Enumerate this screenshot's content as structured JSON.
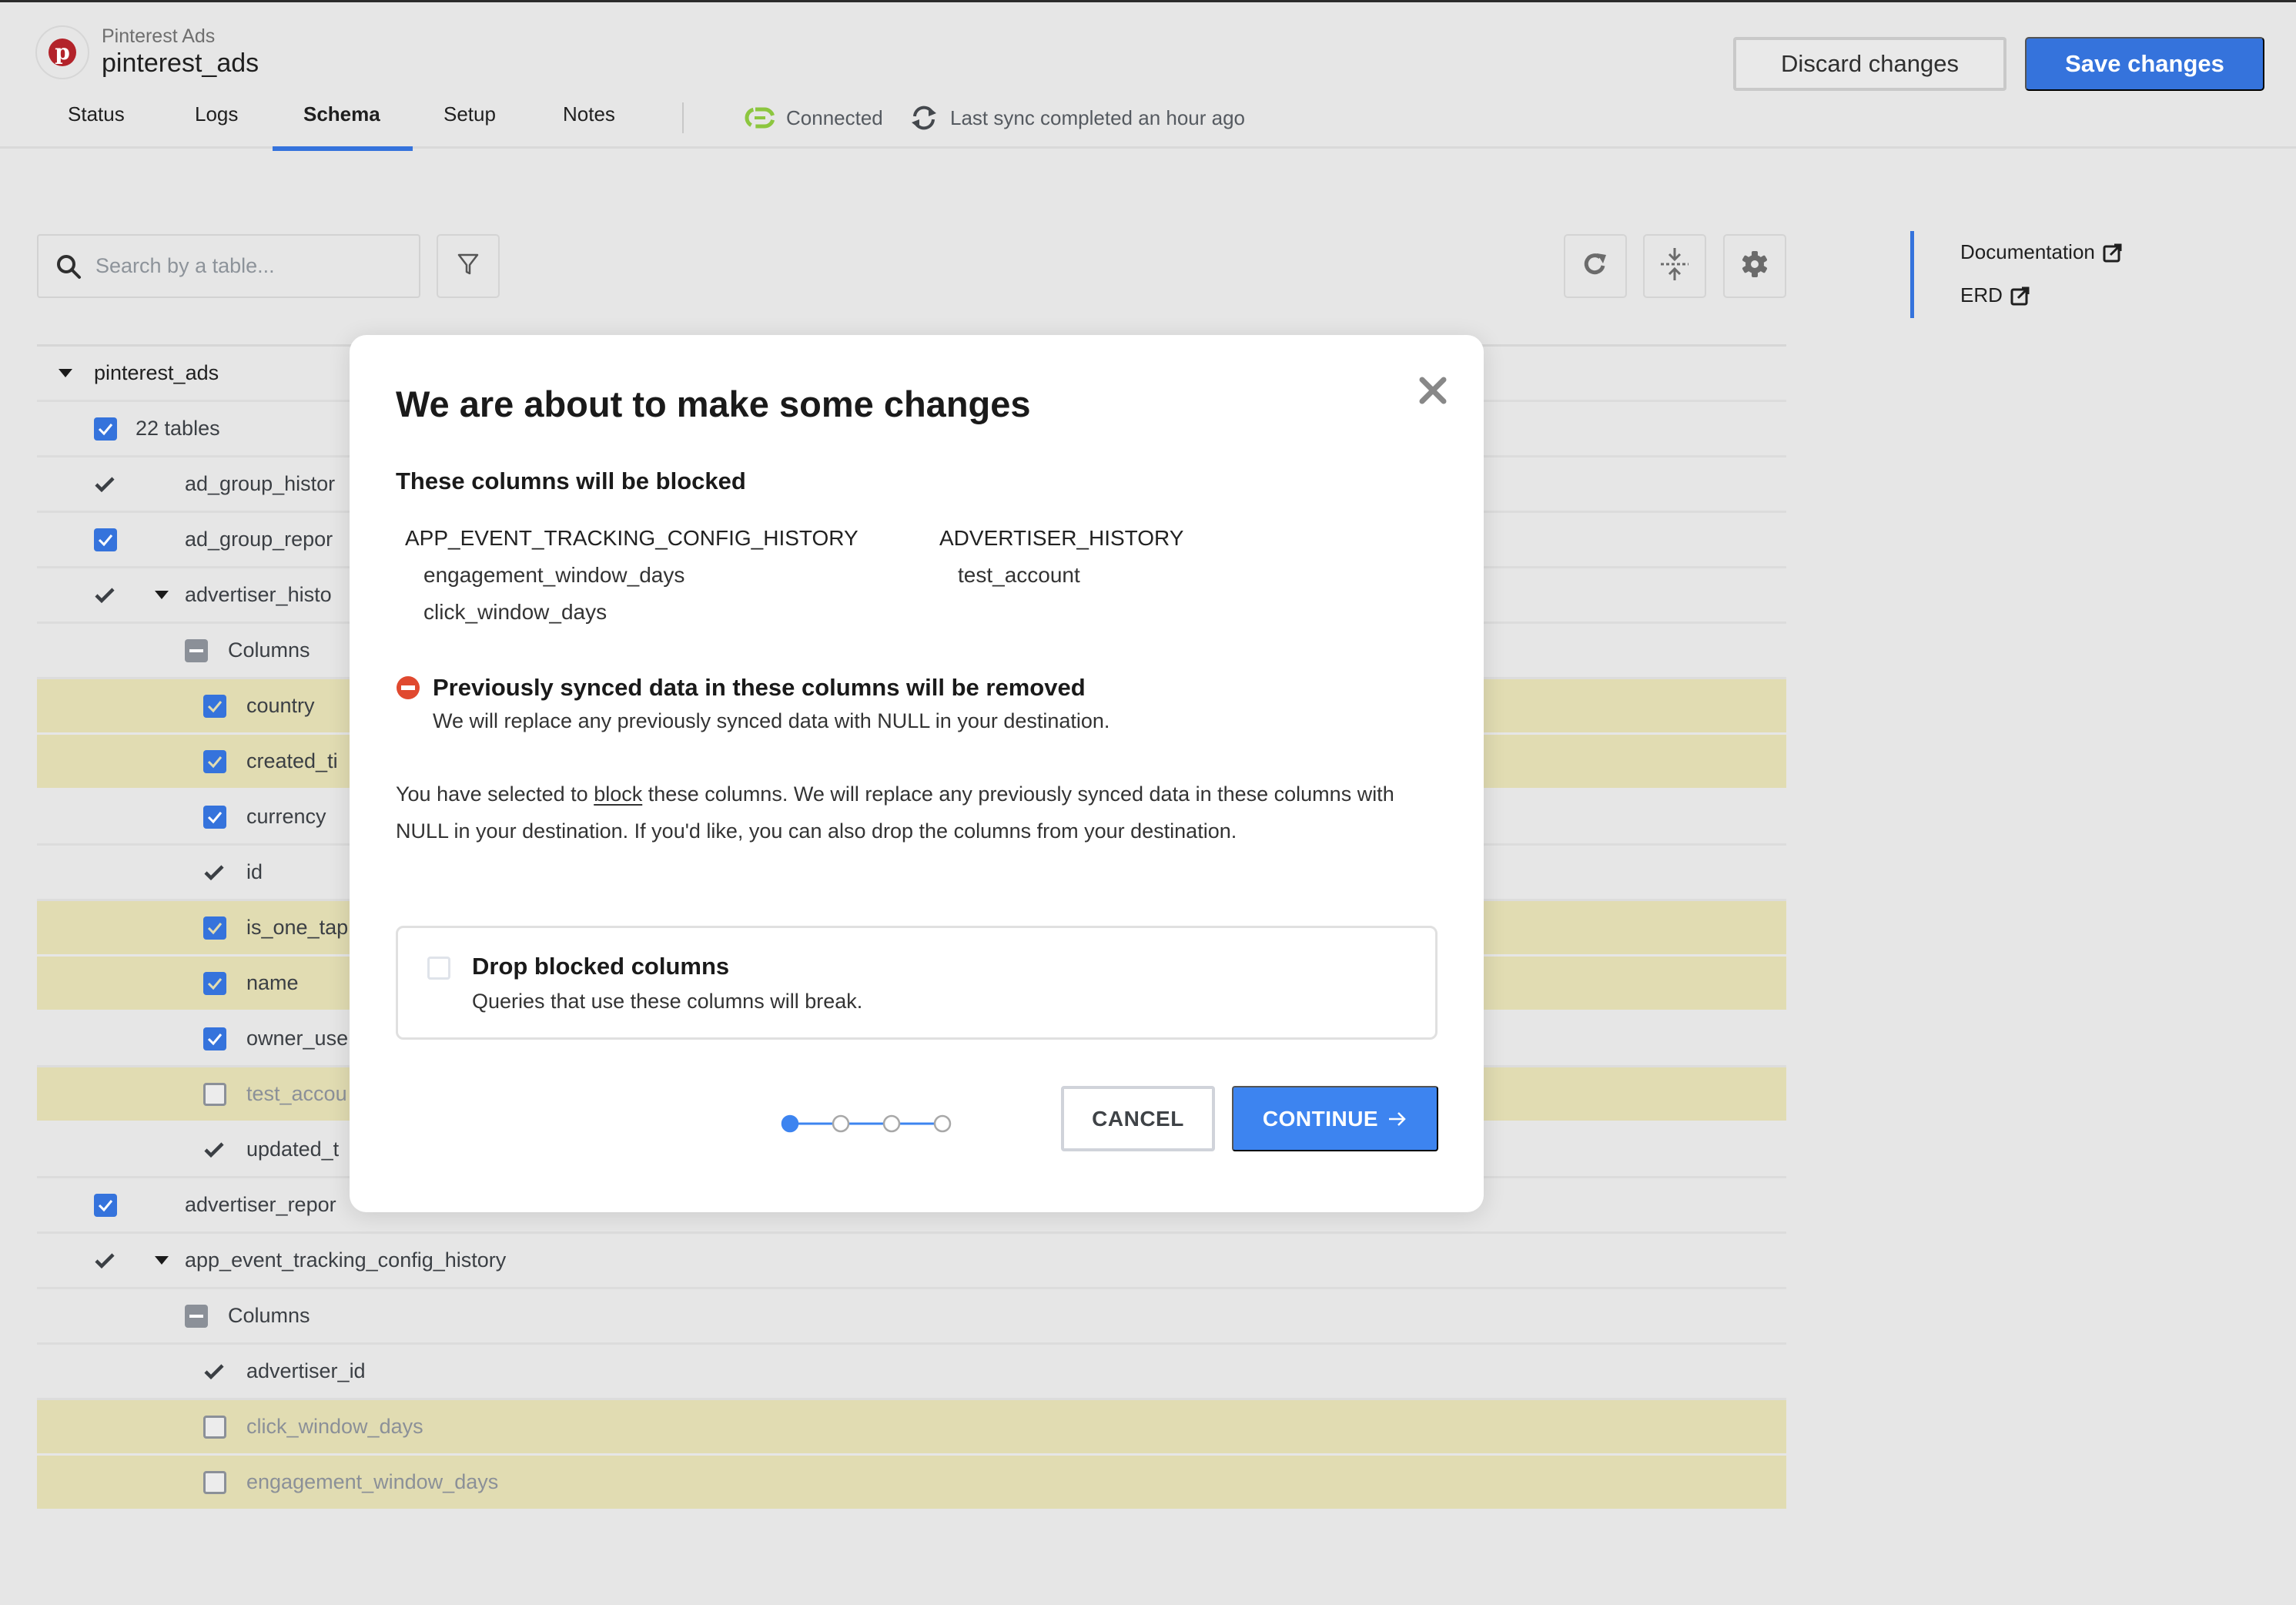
{
  "header": {
    "app_subtitle": "Pinterest Ads",
    "app_title": "pinterest_ads",
    "logo_icon": "pinterest-logo-icon",
    "tabs": [
      {
        "label": "Status",
        "active": false
      },
      {
        "label": "Logs",
        "active": false
      },
      {
        "label": "Schema",
        "active": true
      },
      {
        "label": "Setup",
        "active": false
      },
      {
        "label": "Notes",
        "active": false
      }
    ],
    "connection_status": "Connected",
    "sync_status": "Last sync completed an hour ago",
    "discard_label": "Discard changes",
    "save_label": "Save changes"
  },
  "toolbar": {
    "search_placeholder": "Search by a table...",
    "search_value": "",
    "icons": [
      "search-icon",
      "filter-icon",
      "refresh-icon",
      "collapse-all-icon",
      "gear-icon"
    ]
  },
  "right_rail": {
    "links": [
      {
        "label": "Documentation",
        "icon": "external-link-icon"
      },
      {
        "label": "ERD",
        "icon": "external-link-icon"
      }
    ]
  },
  "tree": {
    "schema_name": "pinterest_ads",
    "tables_count_label": "22 tables",
    "rows": [
      {
        "label": "ad_group_histor",
        "level": "table",
        "state": "locked",
        "expanded": false,
        "highlight": false
      },
      {
        "label": "ad_group_repor",
        "level": "table",
        "state": "checked",
        "expanded": false,
        "highlight": false
      },
      {
        "label": "advertiser_histo",
        "level": "table",
        "state": "locked",
        "expanded": true,
        "highlight": false
      },
      {
        "label": "Columns",
        "level": "columns-header",
        "state": "partial",
        "highlight": false
      },
      {
        "label": "country",
        "level": "column",
        "state": "checked",
        "highlight": true
      },
      {
        "label": "created_ti",
        "level": "column",
        "state": "checked",
        "highlight": true
      },
      {
        "label": "currency",
        "level": "column",
        "state": "checked",
        "highlight": false
      },
      {
        "label": "id",
        "level": "column",
        "state": "locked",
        "highlight": false
      },
      {
        "label": "is_one_tap",
        "level": "column",
        "state": "checked",
        "highlight": true
      },
      {
        "label": "name",
        "level": "column",
        "state": "checked",
        "highlight": true
      },
      {
        "label": "owner_use",
        "level": "column",
        "state": "checked",
        "highlight": false
      },
      {
        "label": "test_accou",
        "level": "column",
        "state": "unchecked",
        "highlight": true
      },
      {
        "label": "updated_t",
        "level": "column",
        "state": "locked",
        "highlight": false
      },
      {
        "label": "advertiser_repor",
        "level": "table",
        "state": "checked",
        "expanded": false,
        "highlight": false
      },
      {
        "label": "app_event_tracking_config_history",
        "level": "table",
        "state": "locked",
        "expanded": true,
        "highlight": false
      },
      {
        "label": "Columns",
        "level": "columns-header",
        "state": "partial",
        "highlight": false
      },
      {
        "label": "advertiser_id",
        "level": "column",
        "state": "locked",
        "highlight": false
      },
      {
        "label": "click_window_days",
        "level": "column",
        "state": "unchecked",
        "highlight": true
      },
      {
        "label": "engagement_window_days",
        "level": "column",
        "state": "unchecked",
        "highlight": true
      }
    ]
  },
  "modal": {
    "title": "We are about to make some changes",
    "blocked_heading": "These columns will be blocked",
    "blocked_groups": [
      {
        "table": "APP_EVENT_TRACKING_CONFIG_HISTORY",
        "columns": [
          "engagement_window_days",
          "click_window_days"
        ]
      },
      {
        "table": "ADVERTISER_HISTORY",
        "columns": [
          "test_account"
        ]
      }
    ],
    "warning_title": "Previously synced data in these columns will be removed",
    "warning_text": "We will replace any previously synced data with NULL in your destination.",
    "explain_prefix": "You have selected to ",
    "explain_link": "block",
    "explain_suffix": " these columns. We will replace any previously synced data in these columns with NULL in your destination. If you'd like, you can also drop the columns from your destination.",
    "drop_option": {
      "title": "Drop blocked columns",
      "subtitle": "Queries that use these columns will break.",
      "checked": false
    },
    "stepper": {
      "total_steps": 4,
      "current_step": 1
    },
    "cancel_label": "CANCEL",
    "continue_label": "CONTINUE"
  },
  "colors": {
    "accent": "#3573dc",
    "continue": "#3d84f0",
    "highlight_row": "#e1dcb2",
    "connected_green": "#8cc63f",
    "warning_red": "#e0492f",
    "pinterest_red": "#b3232a"
  }
}
